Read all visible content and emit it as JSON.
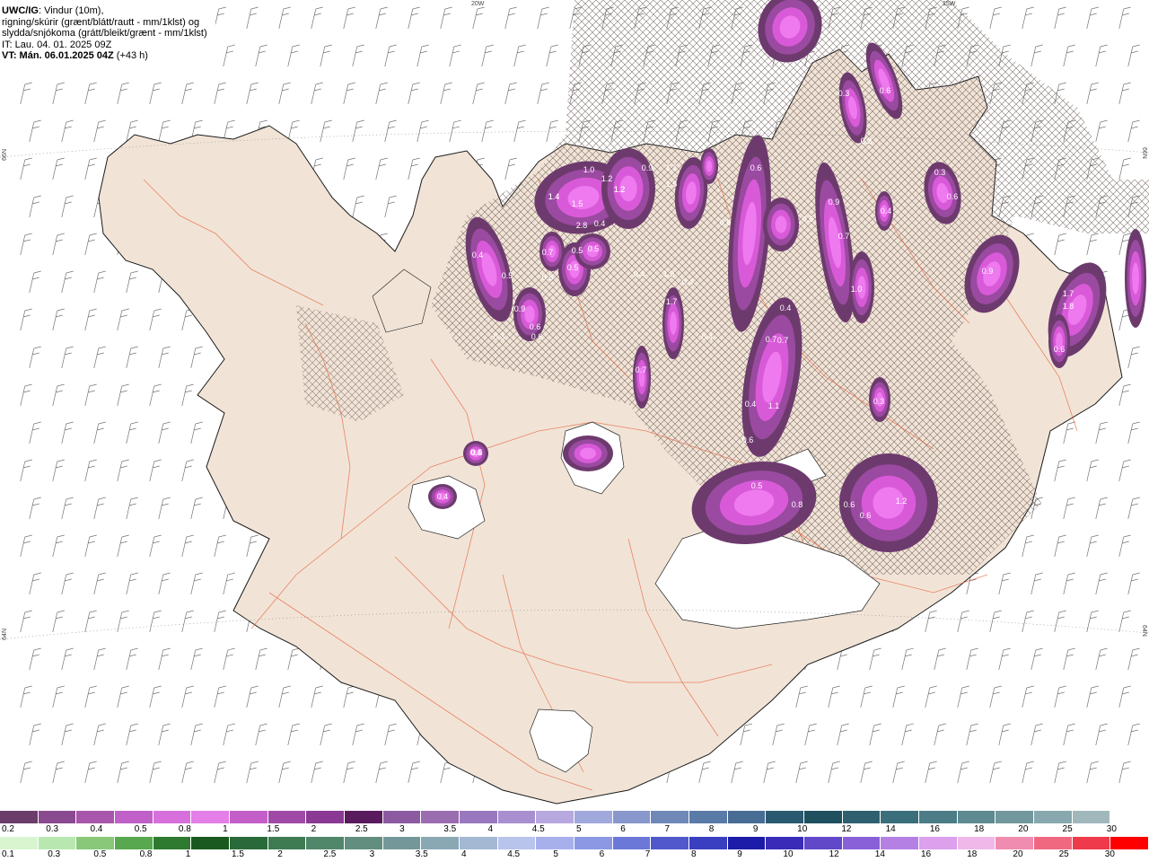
{
  "header": {
    "model": "UWC/IG",
    "line1_rest": ": Vindur (10m),",
    "line2": "rigning/skúrir (grænt/blátt/rautt - mm/1klst) og",
    "line3": "slydda/snjókoma (grátt/bleikt/grænt - mm/1klst)",
    "line4": "IT: Lau. 04. 01. 2025 09Z",
    "vt_label": "VT: Mán. 06.01.2025 04Z",
    "vt_rest": " (+43 h)"
  },
  "graticule": {
    "top_20w": "20W",
    "top_15w": "15W",
    "left_66n": "66N",
    "right_66n": "66N",
    "left_64n": "64N",
    "right_64n": "64N"
  },
  "colors": {
    "land": "#f1e4d7",
    "sea": "#ffffff",
    "roads": "#e8623a",
    "precip_dark": "#6d3a6e",
    "precip_mid": "#9a4aa0",
    "precip_light": "#d95ad8",
    "precip_bright": "#ef7af0"
  },
  "precip_values": [
    "1.0",
    "1.2",
    "0.9",
    "1.1",
    "1.5",
    "1.4",
    "1.2",
    "0.6",
    "0.3",
    "0.6",
    "0.4",
    "0.5",
    "0.9",
    "0.7",
    "1.0",
    "0.3",
    "0.6",
    "1.7",
    "1.8",
    "0.9",
    "0.6",
    "0.4",
    "0.5",
    "0.7",
    "0.8",
    "0.4",
    "1.1",
    "0.4",
    "0.6",
    "0.5",
    "0.8",
    "0.6",
    "0.6",
    "1.2",
    "0.3",
    "0.3",
    "0.4",
    "0.3",
    "0.4",
    "0.4",
    "0.7",
    "1.7",
    "0.4",
    "0.5",
    "0.7",
    "0.9",
    "0.6",
    "0.3",
    "0.5",
    "0.6",
    "0.8",
    "0.7",
    "0.4",
    "0.3",
    "0.5",
    "1.2",
    "1.4",
    "1.5",
    "2.8",
    "0.5",
    "0.4",
    "1.3"
  ],
  "legend": {
    "snow_colors": [
      "#6b3d6b",
      "#8a4a8f",
      "#a856ab",
      "#c060c8",
      "#d770dc",
      "#e37fe6",
      "#c45fc9",
      "#a04aa8",
      "#8a3994",
      "#5a1a5e",
      "#8c5aa0",
      "#9a6cb0",
      "#9a78c0",
      "#a890d0",
      "#b8a8e0",
      "#a0a8dc",
      "#8898cc",
      "#7088b8",
      "#5a7aa8",
      "#486c94",
      "#2a5a70",
      "#1e5060",
      "#2e6070",
      "#3a6e7a",
      "#4c7c86",
      "#5e8a92",
      "#72989e",
      "#88a8ae",
      "#a0b8bc",
      "#ffffff"
    ],
    "snow_labels": [
      "0.2",
      "0.3",
      "0.4",
      "0.5",
      "0.8",
      "1",
      "1.5",
      "2",
      "2.5",
      "3",
      "3.5",
      "4",
      "4.5",
      "5",
      "6",
      "7",
      "8",
      "9",
      "10",
      "12",
      "14",
      "16",
      "18",
      "20",
      "25",
      "30"
    ],
    "rain_colors": [
      "#d8f5d0",
      "#b8e8b0",
      "#88c878",
      "#58a850",
      "#2e7a30",
      "#1a5a20",
      "#2a6a3a",
      "#3e7a52",
      "#50866a",
      "#628e80",
      "#74989a",
      "#8aa8b4",
      "#a4b8d4",
      "#b8c4ec",
      "#a8b0ec",
      "#8c98e4",
      "#6c78d8",
      "#5058cc",
      "#3a3ec0",
      "#1c1ca8",
      "#3a2cb8",
      "#6048c8",
      "#8a60d8",
      "#b480e4",
      "#dca0ec",
      "#f0b8e8",
      "#f08cb0",
      "#f06880",
      "#ee3a4a",
      "#ff0000"
    ],
    "rain_labels": [
      "0.1",
      "0.3",
      "0.5",
      "0.8",
      "1",
      "1.5",
      "2",
      "2.5",
      "3",
      "3.5",
      "4",
      "4.5",
      "5",
      "6",
      "7",
      "8",
      "9",
      "10",
      "12",
      "14",
      "16",
      "18",
      "20",
      "25",
      "30"
    ]
  }
}
